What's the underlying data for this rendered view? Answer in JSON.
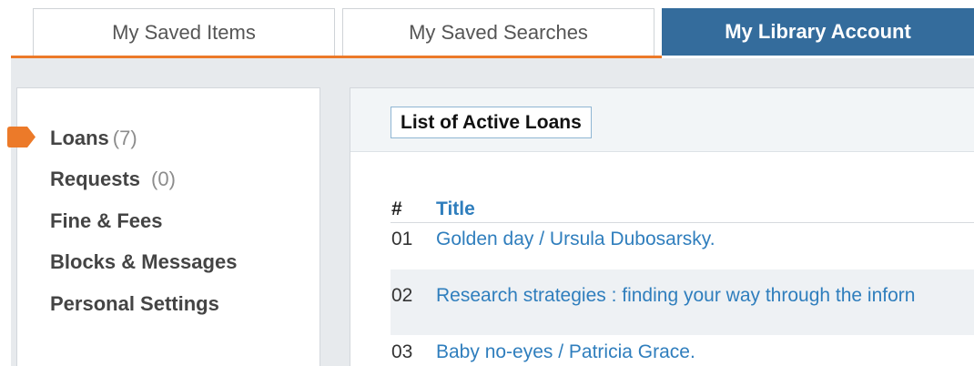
{
  "tabs": [
    {
      "label": "My Saved Items",
      "active": false
    },
    {
      "label": "My Saved Searches",
      "active": false
    },
    {
      "label": "My Library Account",
      "active": true
    }
  ],
  "colors": {
    "accent_orange": "#ec7a29",
    "active_tab": "#346c9c",
    "link_blue": "#2f7ebd"
  },
  "sidebar": {
    "marker_icon": "orange-arrow-tab",
    "items": [
      {
        "label": "Loans",
        "count": "(7)",
        "selected": true
      },
      {
        "label": "Requests",
        "count": "(0)",
        "selected": false
      },
      {
        "label": "Fine & Fees"
      },
      {
        "label": "Blocks & Messages"
      },
      {
        "label": "Personal Settings"
      }
    ]
  },
  "main": {
    "title": "List of Active Loans",
    "table": {
      "columns": [
        "#",
        "Title"
      ],
      "rows": [
        {
          "num": "01",
          "title": "Golden day / Ursula Dubosarsky."
        },
        {
          "num": "02",
          "title": "Research strategies : finding your way through the inforn"
        },
        {
          "num": "03",
          "title": "Baby no-eyes / Patricia Grace."
        }
      ]
    }
  }
}
